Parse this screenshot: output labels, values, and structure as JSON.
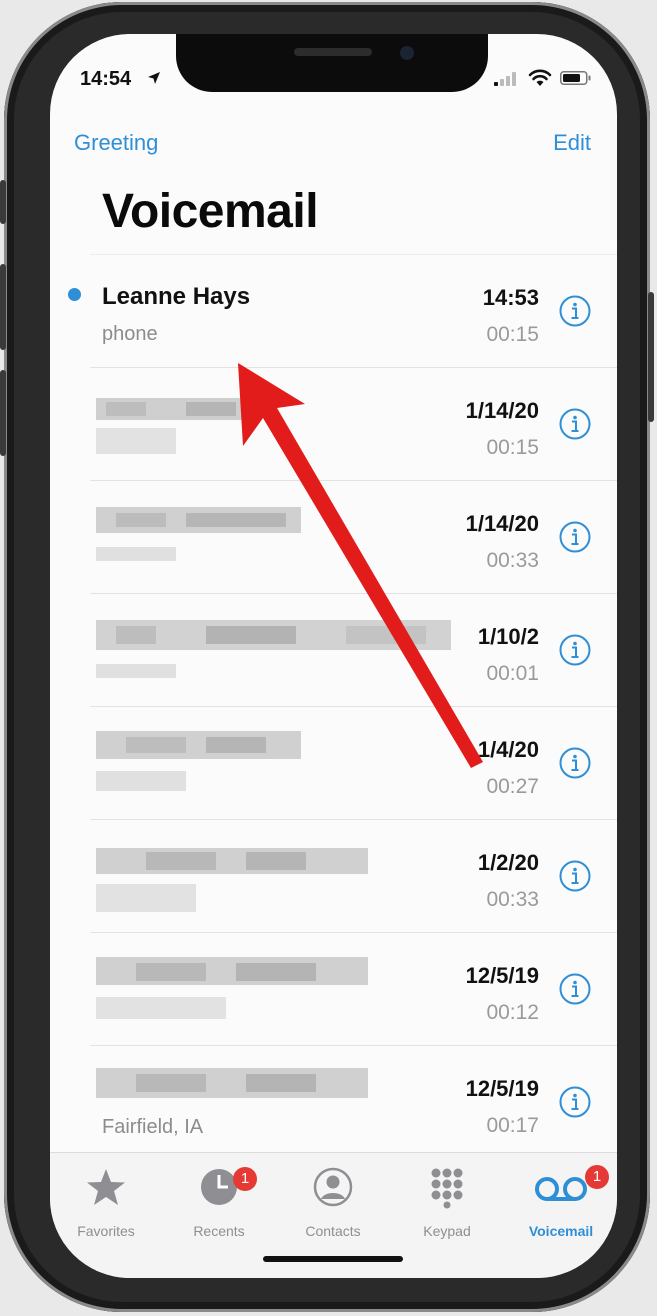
{
  "status_bar": {
    "time": "14:54"
  },
  "nav": {
    "left": "Greeting",
    "right": "Edit"
  },
  "title": "Voicemail",
  "voicemails": [
    {
      "name": "Leanne Hays",
      "sub": "phone",
      "date": "14:53",
      "duration": "00:15",
      "unread": true
    },
    {
      "name": "",
      "sub": "",
      "date": "1/14/20",
      "duration": "00:15",
      "unread": false
    },
    {
      "name": "",
      "sub": "",
      "date": "1/14/20",
      "duration": "00:33",
      "unread": false
    },
    {
      "name": "",
      "sub": "",
      "date": "1/10/2",
      "duration": "00:01",
      "unread": false
    },
    {
      "name": "",
      "sub": "",
      "date": "1/4/20",
      "duration": "00:27",
      "unread": false
    },
    {
      "name": "",
      "sub": "",
      "date": "1/2/20",
      "duration": "00:33",
      "unread": false
    },
    {
      "name": "",
      "sub": "",
      "date": "12/5/19",
      "duration": "00:12",
      "unread": false
    },
    {
      "name": "",
      "sub": "Fairfield, IA",
      "date": "12/5/19",
      "duration": "00:17",
      "unread": false
    }
  ],
  "tabs": [
    {
      "label": "Favorites",
      "icon": "star-icon",
      "badge": ""
    },
    {
      "label": "Recents",
      "icon": "clock-icon",
      "badge": "1"
    },
    {
      "label": "Contacts",
      "icon": "person-circle-icon",
      "badge": ""
    },
    {
      "label": "Keypad",
      "icon": "keypad-icon",
      "badge": ""
    },
    {
      "label": "Voicemail",
      "icon": "voicemail-icon",
      "badge": "1",
      "active": true
    }
  ],
  "colors": {
    "accent": "#2f8fd6",
    "badge": "#e53935",
    "annotation_arrow": "#e21b1b"
  }
}
